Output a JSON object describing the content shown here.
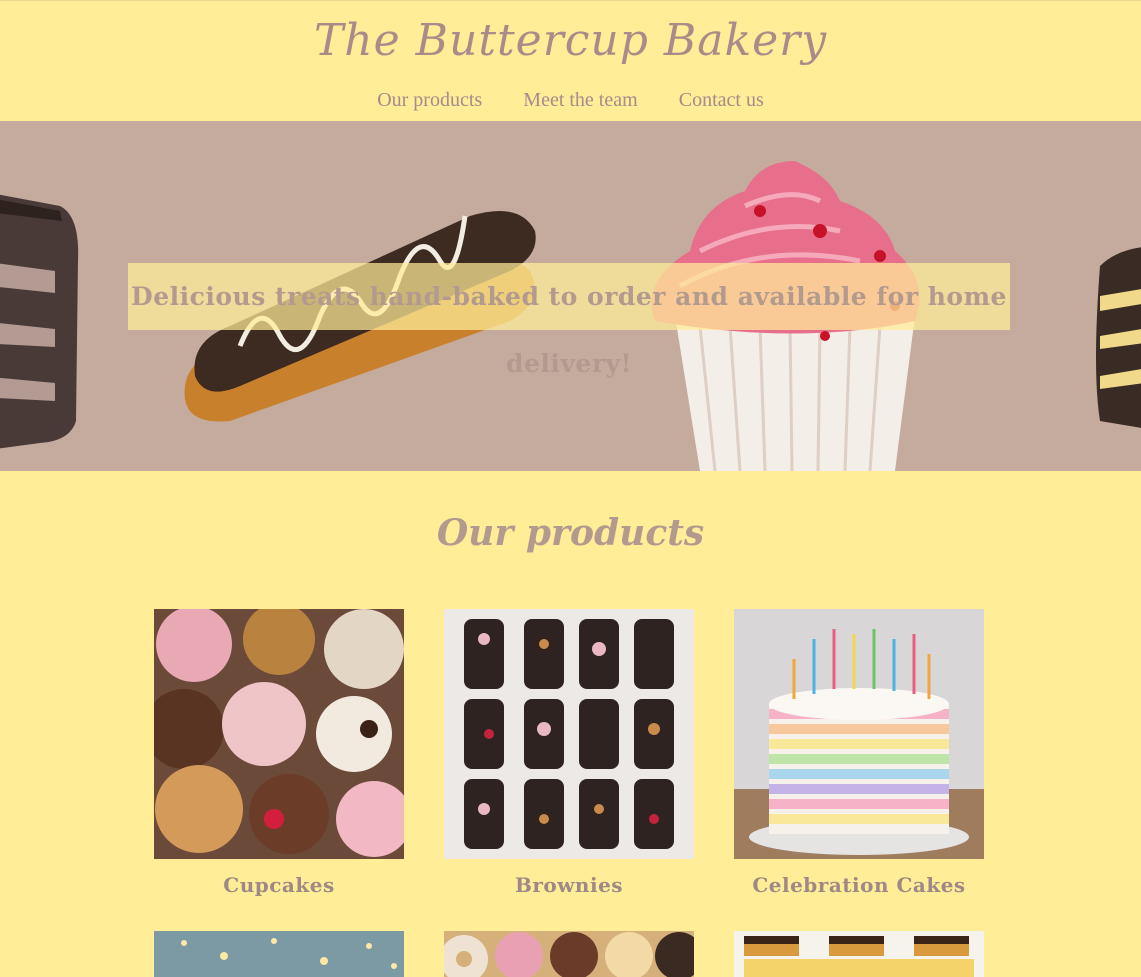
{
  "header": {
    "logo": "The Buttercup Bakery",
    "nav": [
      "Our products",
      "Meet the team",
      "Contact us"
    ]
  },
  "hero": {
    "tagline": "Delicious treats hand-baked to order and available for home delivery!"
  },
  "products": {
    "title": "Our products",
    "items": [
      {
        "label": "Cupcakes"
      },
      {
        "label": "Brownies"
      },
      {
        "label": "Celebration Cakes"
      }
    ]
  },
  "colors": {
    "background": "#ffed98",
    "hero_bg": "#c5ab9e",
    "text": "#ac9594"
  }
}
